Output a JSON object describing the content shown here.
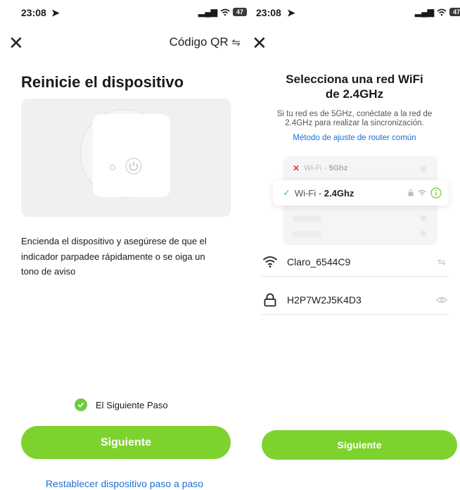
{
  "left_screen": {
    "status": {
      "time": "23:08",
      "signal": "▂▄▆",
      "battery": "47"
    },
    "header": {
      "qr_label": "Código QR"
    },
    "title": "Reinicie el dispositivo",
    "description": "Encienda el dispositivo y asegúrese de que el indicador parpadee rápidamente o se oiga un tono de aviso",
    "confirm_label": "El Siguiente Paso",
    "next_button": "Siguiente",
    "reset_link": "Restablecer dispositivo paso a paso"
  },
  "right_screen": {
    "status": {
      "time": "23:08",
      "signal": "▂▄▆",
      "battery": "47"
    },
    "title_line1": "Selecciona una red WiFi",
    "title_line2": "de 2.4GHz",
    "subtitle_line1": "Si tu red es de 5GHz, conéctate a la red de",
    "subtitle_line2": "2.4GHz para realizar la sincronización.",
    "router_link": "Método de ajuste de router común",
    "illustration": {
      "wifi_5g_prefix": "Wi-Fi - ",
      "wifi_5g_band": "5Ghz",
      "wifi_24_prefix": "Wi-Fi - ",
      "wifi_24_band": "2.4Ghz"
    },
    "ssid": "Claro_6544C9",
    "password": "H2P7W2J5K4D3",
    "next_button": "Siguiente"
  },
  "colors": {
    "accent_green": "#7ed22e",
    "link_blue": "#1f6fd1",
    "check_green": "#6fcb3e",
    "error_red": "#e03b3b"
  },
  "icons": [
    "close-icon",
    "switch-arrows-icon",
    "power-icon",
    "check-circle-icon",
    "wifi-icon",
    "lock-icon",
    "eye-icon",
    "info-icon"
  ]
}
